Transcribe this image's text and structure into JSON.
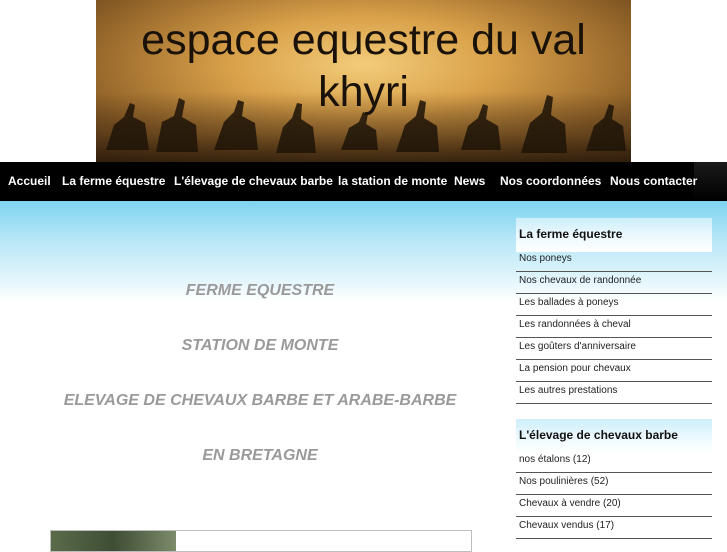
{
  "header": {
    "title": "espace equestre du val khyri"
  },
  "nav": {
    "items": [
      "Accueil",
      "La ferme équestre",
      "L'élevage de chevaux barbe",
      "la station de monte",
      "News",
      "Nos coordonnées",
      "Nous contacter"
    ]
  },
  "main": {
    "lines": [
      "FERME EQUESTRE",
      "STATION DE MONTE",
      "ELEVAGE DE CHEVAUX BARBE ET ARABE-BARBE",
      "EN BRETAGNE"
    ]
  },
  "sidebar": {
    "sections": [
      {
        "title": "La ferme équestre",
        "items": [
          "Nos poneys",
          "Nos chevaux de randonnée",
          "Les ballades à poneys",
          "Les randonnées à cheval",
          "Les goûters d'anniversaire",
          "La pension pour chevaux",
          "Les autres prestations"
        ]
      },
      {
        "title": "L'élevage de chevaux barbe",
        "items": [
          "nos étalons (12)",
          "Nos poulinières (52)",
          "Chevaux à vendre (20)",
          "Chevaux vendus (17)"
        ]
      }
    ]
  }
}
